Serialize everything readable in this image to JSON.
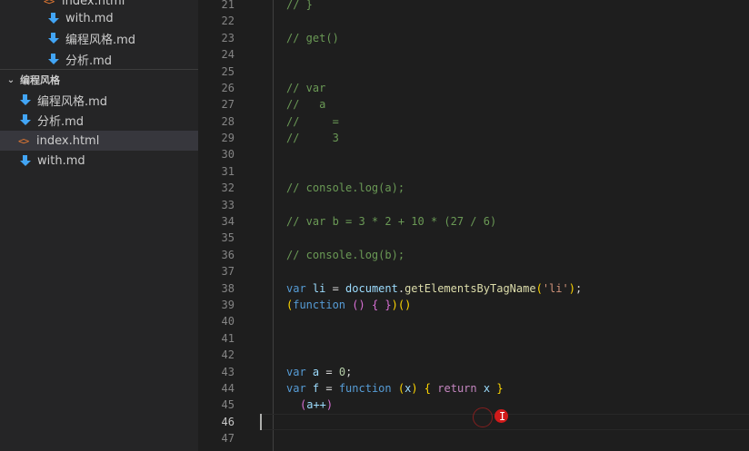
{
  "explorer": {
    "items": [
      {
        "label": "index.html",
        "type": "html"
      },
      {
        "label": "with.md",
        "type": "md"
      },
      {
        "label": "编程风格.md",
        "type": "md"
      },
      {
        "label": "分析.md",
        "type": "md"
      }
    ],
    "folder": {
      "label": "编程风格",
      "expanded": true
    },
    "folder_items": [
      {
        "label": "编程风格.md",
        "type": "md"
      },
      {
        "label": "分析.md",
        "type": "md"
      },
      {
        "label": "index.html",
        "type": "html",
        "selected": true
      },
      {
        "label": "with.md",
        "type": "md"
      }
    ]
  },
  "editor": {
    "line_numbers": [
      "21",
      "22",
      "23",
      "24",
      "25",
      "26",
      "27",
      "28",
      "29",
      "30",
      "31",
      "32",
      "33",
      "34",
      "35",
      "36",
      "37",
      "38",
      "39",
      "40",
      "41",
      "42",
      "43",
      "44",
      "45",
      "46",
      "47"
    ],
    "active_line": "46",
    "lines": {
      "l21": "// }",
      "l23": "// get()",
      "l26": "// var",
      "l27": "//   a",
      "l28": "//     =",
      "l29": "//     3",
      "l32": "// console.log(a);",
      "l34": "// var b = 3 * 2 + 10 * (27 / 6)",
      "l36": "// console.log(b);",
      "l38": {
        "kw": "var",
        "name": " li ",
        "eq": "= ",
        "obj": "document",
        "dot": ".",
        "method": "getElementsByTagName",
        "open": "(",
        "str": "'li'",
        "close": ")",
        "semi": ";"
      },
      "l39": {
        "p1": "(",
        "kw": "function",
        "sp": " ",
        "p2": "()",
        "sp2": " ",
        "p3": "{ }",
        "p4": ")",
        "p5": "()"
      },
      "l43": {
        "kw": "var",
        "name": " a ",
        "eq": "= ",
        "num": "0",
        "semi": ";"
      },
      "l44": {
        "kw": "var",
        "name": " f ",
        "eq": "= ",
        "kw2": "function",
        "sp": " ",
        "p1o": "(",
        "arg": "x",
        "p1c": ")",
        "sp2": " ",
        "bo": "{",
        "sp3": " ",
        "ret": "return",
        "sp4": " ",
        "x": "x",
        "sp5": " ",
        "bc": "}"
      },
      "l45": {
        "po": "(",
        "expr": "a++",
        "pc": ")"
      }
    }
  },
  "cursor_glyph": "I"
}
